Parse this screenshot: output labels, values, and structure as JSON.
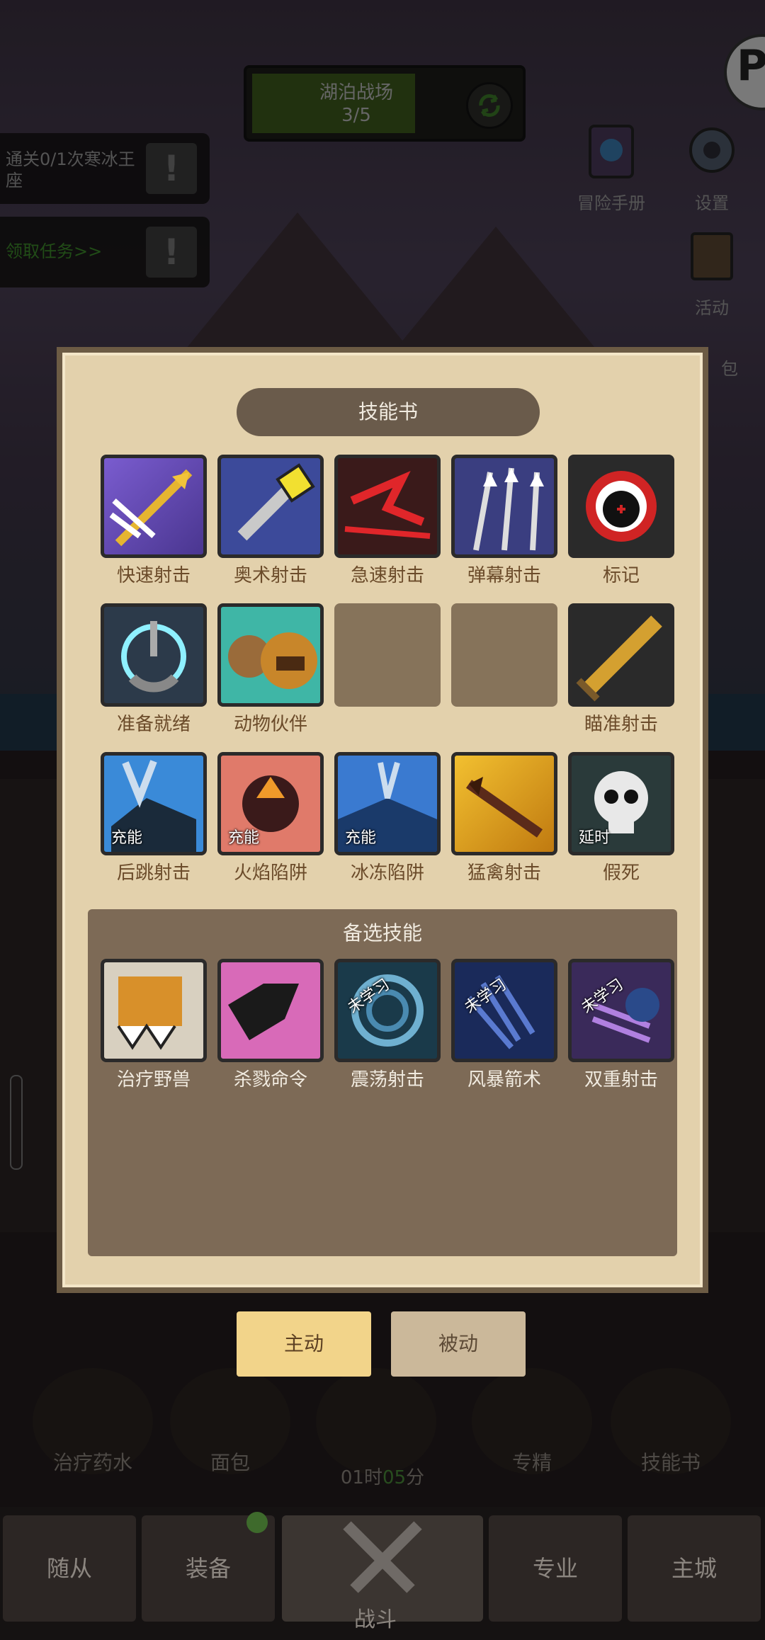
{
  "top": {
    "battlefield_name": "湖泊战场",
    "battlefield_count": "3/5",
    "quests": [
      {
        "text": "通关0/1次寒冰王座"
      },
      {
        "text": "领取任务>>"
      }
    ],
    "side_buttons": {
      "handbook": "冒险手册",
      "settings": "设置",
      "activity": "活动",
      "bag_partial": "包"
    },
    "p_badge": "P"
  },
  "modal": {
    "title": "技能书",
    "equipped_skills": [
      {
        "name": "快速射击",
        "tag": ""
      },
      {
        "name": "奥术射击",
        "tag": ""
      },
      {
        "name": "急速射击",
        "tag": ""
      },
      {
        "name": "弹幕射击",
        "tag": ""
      },
      {
        "name": "标记",
        "tag": ""
      },
      {
        "name": "准备就绪",
        "tag": ""
      },
      {
        "name": "动物伙伴",
        "tag": ""
      },
      {
        "name": "",
        "tag": ""
      },
      {
        "name": "",
        "tag": ""
      },
      {
        "name": "瞄准射击",
        "tag": ""
      },
      {
        "name": "后跳射击",
        "tag": "充能"
      },
      {
        "name": "火焰陷阱",
        "tag": "充能"
      },
      {
        "name": "冰冻陷阱",
        "tag": "充能"
      },
      {
        "name": "猛禽射击",
        "tag": ""
      },
      {
        "name": "假死",
        "tag": "延时"
      }
    ],
    "backup_title": "备选技能",
    "backup_skills": [
      {
        "name": "治疗野兽",
        "tag": ""
      },
      {
        "name": "杀戮命令",
        "tag": ""
      },
      {
        "name": "震荡射击",
        "tag": "未学习"
      },
      {
        "name": "风暴箭术",
        "tag": "未学习"
      },
      {
        "name": "双重射击",
        "tag": "未学习"
      }
    ]
  },
  "tabs": {
    "active": "主动",
    "passive": "被动"
  },
  "actions": [
    {
      "label": "治疗药水"
    },
    {
      "label": "面包"
    },
    {
      "label": ""
    },
    {
      "label": "专精"
    },
    {
      "label": "技能书"
    }
  ],
  "timer": {
    "prefix": "01时",
    "minutes": "05",
    "suffix": "分"
  },
  "nav": {
    "followers": "随从",
    "equipment": "装备",
    "battle": "战斗",
    "specialty": "专业",
    "main_city": "主城"
  }
}
